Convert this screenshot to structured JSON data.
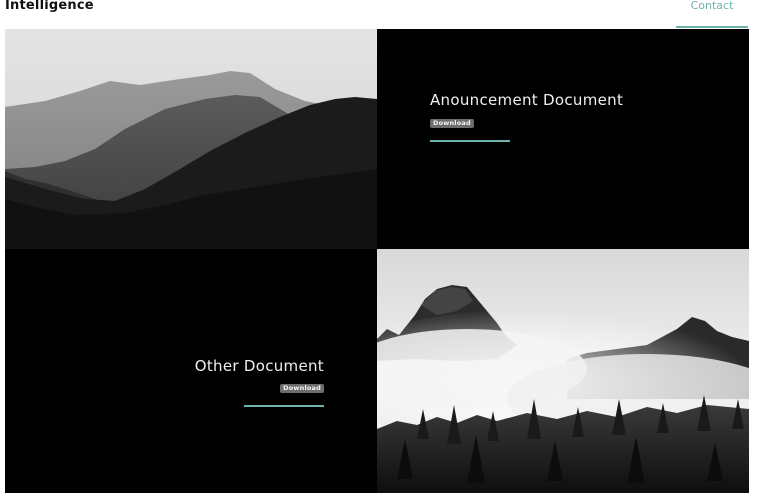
{
  "header": {
    "brand": "Intelligence",
    "nav": {
      "contact_label": "Contact"
    },
    "accent_color": "#6fb3ad"
  },
  "documents": [
    {
      "title": "Anouncement Document",
      "download_label": "Download"
    },
    {
      "title": "Other Document",
      "download_label": "Download"
    }
  ],
  "images": [
    {
      "name": "mountain-ridges-photo"
    },
    {
      "name": "foggy-peaks-forest-photo"
    }
  ]
}
